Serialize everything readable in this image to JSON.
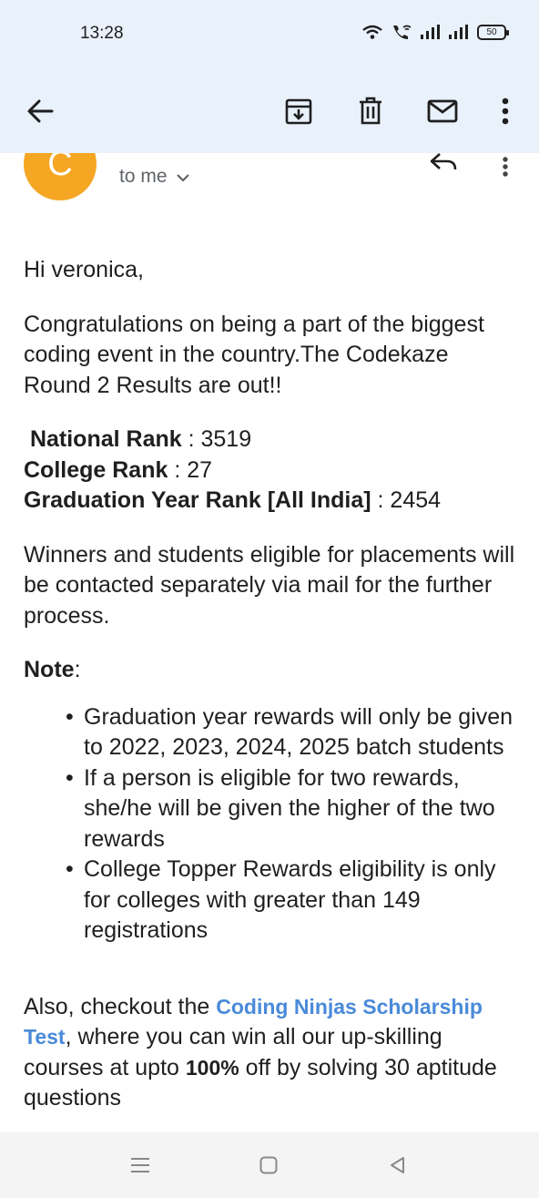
{
  "status_bar": {
    "time": "13:28",
    "battery": "50",
    "icons": [
      "wifi-icon",
      "wifi-call-icon",
      "signal-icon",
      "signal-icon",
      "battery-icon"
    ]
  },
  "toolbar": {
    "icons": [
      "back-arrow-icon",
      "archive-icon",
      "delete-icon",
      "mail-icon",
      "more-vert-icon"
    ]
  },
  "message": {
    "sender_initial": "C",
    "recipient_label": "to me",
    "avatar_color": "#f5a623",
    "greeting": "Hi veronica,",
    "intro": "Congratulations on being a part of the biggest coding event in the country.The Codekaze Round 2 Results are out!!",
    "ranks": [
      {
        "label": "National Rank",
        "separator": " : ",
        "value": "3519"
      },
      {
        "label": "College Rank",
        "separator": " : ",
        "value": "27"
      },
      {
        "label": "Graduation Year Rank [All India]",
        "separator": " : ",
        "value": "2454"
      }
    ],
    "winners_text": "Winners and students eligible for placements will be contacted separately via mail for the further process.",
    "note_label": "Note",
    "note_colon": ":",
    "notes": [
      "Graduation year rewards will only be given to 2022, 2023, 2024, 2025 batch students",
      "If a person is eligible for two rewards, she/he will be given the higher of the two rewards",
      "College Topper Rewards eligibility is only for colleges with greater than 149 registrations"
    ],
    "also_prefix": "Also, checkout the ",
    "link_text": "Coding Ninjas Scholarship Test",
    "also_middle": ", where you can win all our up-skilling courses at upto ",
    "discount": "100%",
    "also_suffix": " off by solving 30 aptitude questions"
  },
  "colors": {
    "header_bg": "#e9f1fb",
    "link": "#4a8ad9",
    "avatar": "#f5a623"
  },
  "nav_bar": {
    "icons": [
      "menu-icon",
      "home-icon",
      "back-icon"
    ]
  }
}
